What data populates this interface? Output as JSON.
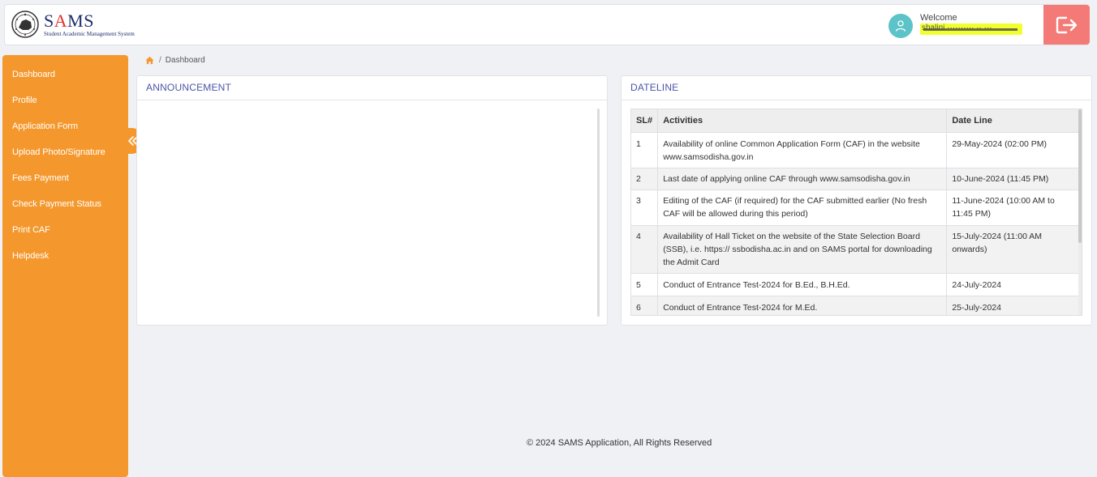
{
  "header": {
    "logo": {
      "title_prefix": "S",
      "title_accent": "A",
      "title_suffix": "MS",
      "subtitle": "Student Academic Management System"
    },
    "user": {
      "welcome": "Welcome",
      "name": "shalini ·········· ·· ···"
    },
    "icons": {
      "avatar": "user-icon",
      "logout": "logout-icon"
    }
  },
  "sidebar": {
    "items": [
      {
        "label": "Dashboard"
      },
      {
        "label": "Profile"
      },
      {
        "label": "Application Form"
      },
      {
        "label": "Upload Photo/Signature"
      },
      {
        "label": "Fees Payment"
      },
      {
        "label": "Check Payment Status"
      },
      {
        "label": "Print CAF"
      },
      {
        "label": "Helpdesk"
      }
    ],
    "collapse_icon": "double-chevron-left-icon"
  },
  "breadcrumb": {
    "home_icon": "home-icon",
    "separator": "/",
    "current": "Dashboard"
  },
  "announcement": {
    "title": "ANNOUNCEMENT"
  },
  "dateline": {
    "title": "DATELINE",
    "columns": [
      "SL#",
      "Activities",
      "Date Line"
    ],
    "rows": [
      {
        "sl": "1",
        "activity": "Availability of online Common Application Form (CAF) in the website www.samsodisha.gov.in",
        "date": "29-May-2024 (02:00 PM)"
      },
      {
        "sl": "2",
        "activity": "Last date of applying online CAF through www.samsodisha.gov.in",
        "date": "10-June-2024 (11:45 PM)"
      },
      {
        "sl": "3",
        "activity": "Editing of the CAF (if required) for the CAF submitted earlier (No fresh CAF will be allowed during this period)",
        "date": "11-June-2024 (10:00 AM to 11:45 PM)"
      },
      {
        "sl": "4",
        "activity": "Availability of Hall Ticket on the website of the State Selection Board (SSB), i.e. https:// ssbodisha.ac.in and on SAMS portal for downloading the Admit Card",
        "date": "15-July-2024 (11:00 AM onwards)"
      },
      {
        "sl": "5",
        "activity": "Conduct of Entrance Test-2024 for B.Ed., B.H.Ed.",
        "date": "24-July-2024"
      },
      {
        "sl": "6",
        "activity": "Conduct of Entrance Test-2024 for M.Ed.",
        "date": "25-July-2024"
      }
    ]
  },
  "footer": {
    "text": "© 2024 SAMS Application, All Rights Reserved"
  },
  "colors": {
    "sidebar": "#f4982d",
    "logout": "#f37a76",
    "avatar": "#5cc3c9",
    "card_title": "#4b55a8"
  }
}
